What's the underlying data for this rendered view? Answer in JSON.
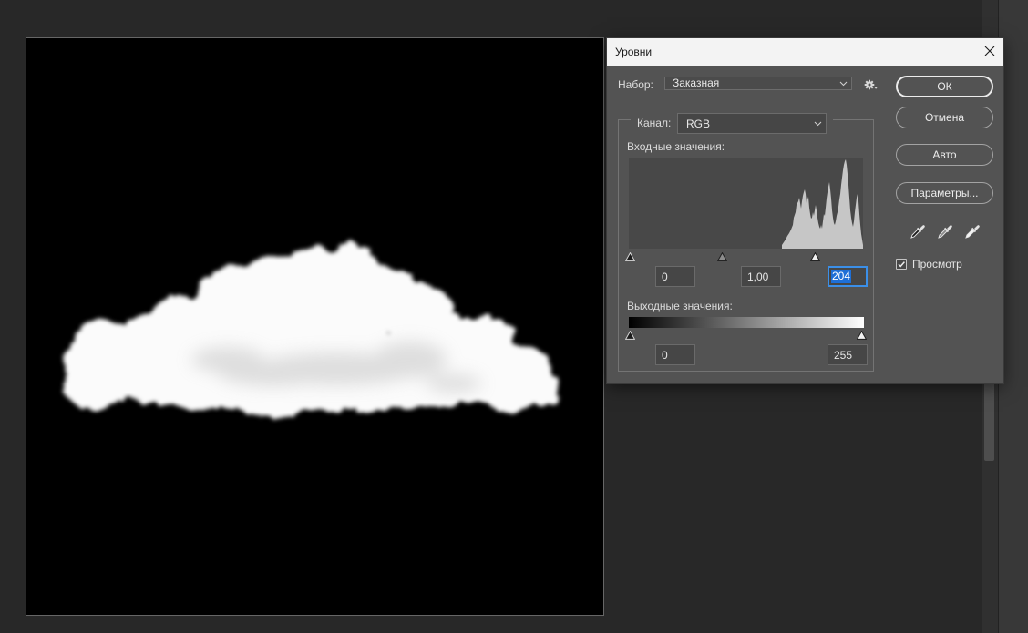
{
  "dialog": {
    "title": "Уровни",
    "preset": {
      "label": "Набор:",
      "value": "Заказная"
    },
    "channel": {
      "label": "Канал:",
      "value": "RGB"
    },
    "input_levels": {
      "label": "Входные значения:",
      "black": "0",
      "gamma": "1,00",
      "white": "204",
      "white_focused": true
    },
    "output_levels": {
      "label": "Выходные значения:",
      "black": "0",
      "white": "255"
    },
    "buttons": {
      "ok": "ОК",
      "cancel": "Отмена",
      "auto": "Авто",
      "options": "Параметры..."
    },
    "preview": {
      "label": "Просмотр",
      "checked": true
    }
  },
  "icons": {
    "close": "close-icon",
    "preset_dropdown": "chevron-down-icon",
    "preset_menu": "gear-icon",
    "channel_dropdown": "chevron-down-icon",
    "eyedroppers": [
      "eyedropper-black-icon",
      "eyedropper-gray-icon",
      "eyedropper-white-icon"
    ],
    "preview_check": "checkmark-icon"
  },
  "colors": {
    "workspace_bg": "#282828",
    "dialog_bg": "#535353",
    "canvas_bg": "#000000",
    "histogram_fill": "#c6c6c6",
    "focus_border": "#3b8fe8",
    "selection_highlight": "#1e6fd6"
  }
}
